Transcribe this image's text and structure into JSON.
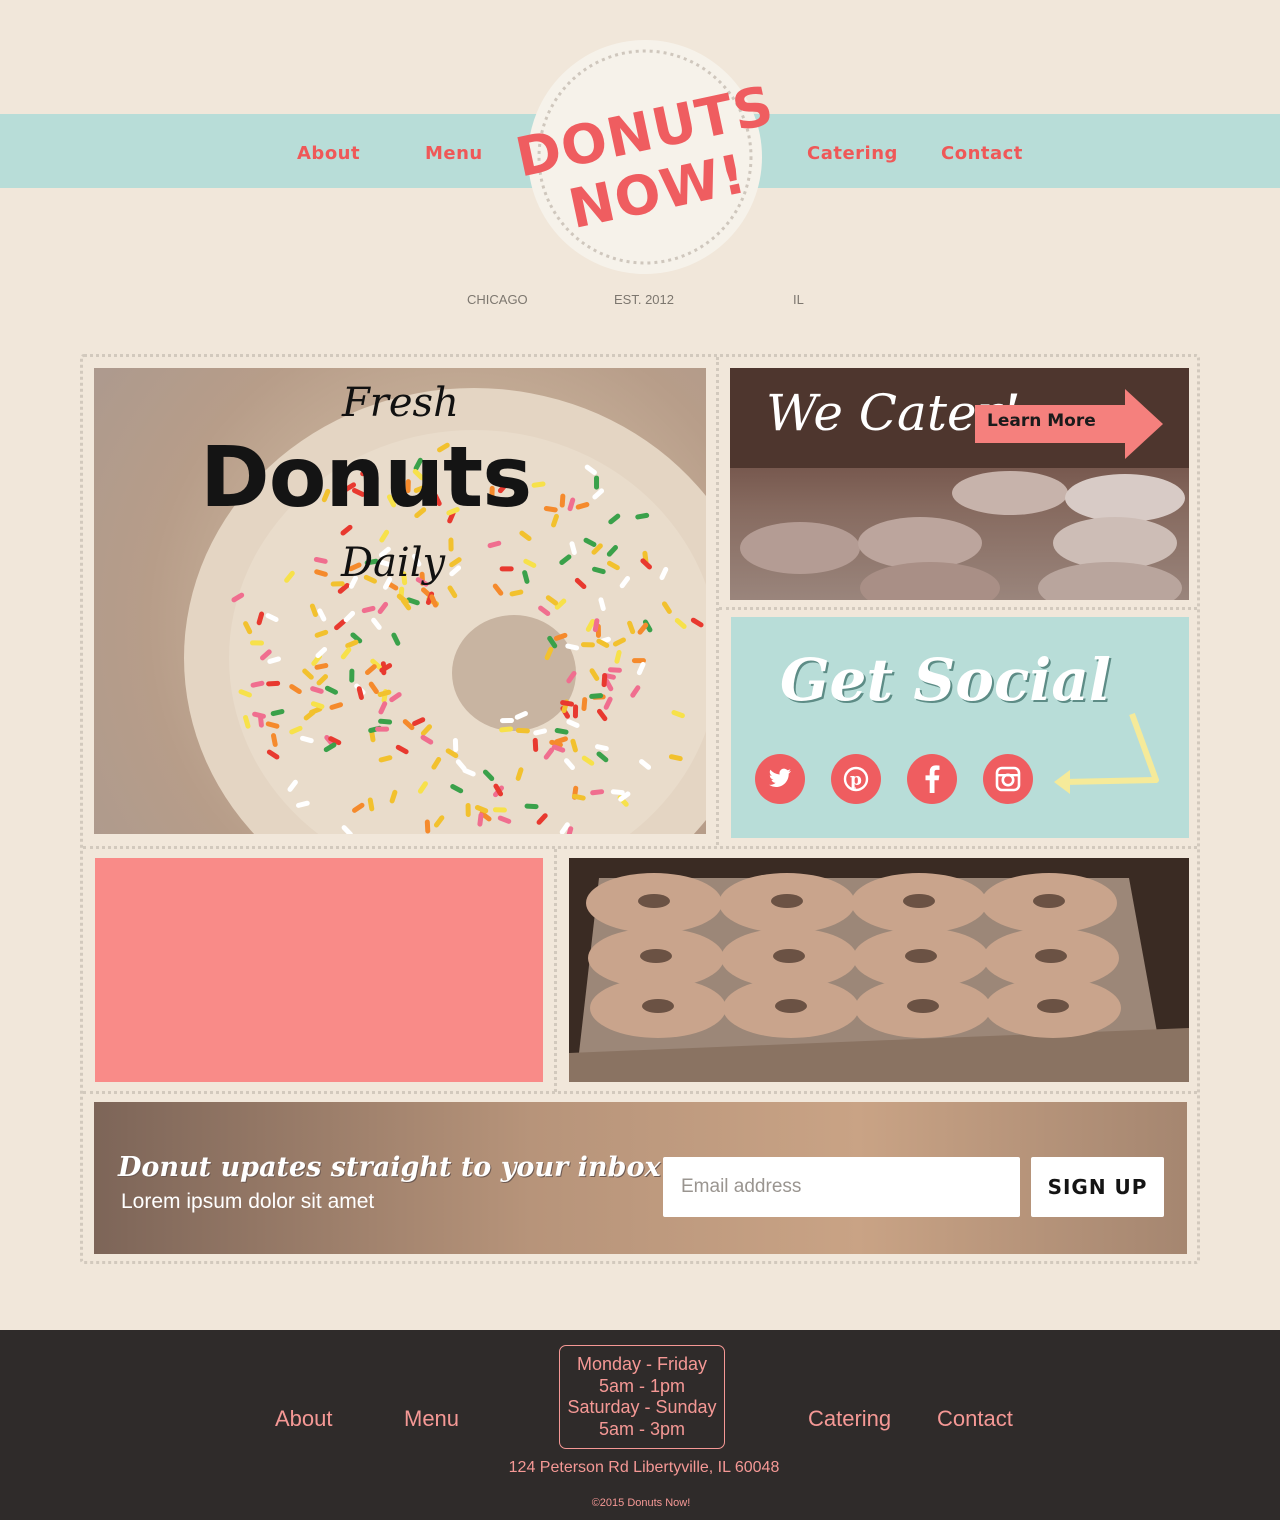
{
  "header": {
    "nav_left": [
      {
        "label": "About"
      },
      {
        "label": "Menu"
      }
    ],
    "nav_right": [
      {
        "label": "Catering"
      },
      {
        "label": "Contact"
      }
    ],
    "logo_line1": "DONUTS",
    "logo_line2": "NOW!",
    "tagline": {
      "city": "CHICAGO",
      "established": "EST. 2012",
      "state": "IL"
    }
  },
  "hero": {
    "line1": "Fresh",
    "line2": "Donuts",
    "line3": "Daily"
  },
  "cater": {
    "title": "We Cater!",
    "button_label": "Learn More"
  },
  "social": {
    "title": "Get Social",
    "icons": [
      "twitter-icon",
      "pinterest-icon",
      "facebook-icon",
      "instagram-icon"
    ]
  },
  "newsletter": {
    "title": "Donut upates straight to your inbox",
    "subtitle": "Lorem ipsum dolor sit amet",
    "email_placeholder": "Email address",
    "button_label": "SIGN UP"
  },
  "footer": {
    "nav_left": [
      {
        "label": "About"
      },
      {
        "label": "Menu"
      }
    ],
    "nav_right": [
      {
        "label": "Catering"
      },
      {
        "label": "Contact"
      }
    ],
    "hours": [
      "Monday - Friday",
      "5am - 1pm",
      "Saturday - Sunday",
      "5am - 3pm"
    ],
    "address": "124 Peterson Rd Libertyville, IL 60048",
    "copyright": "©2015 Donuts Now!"
  },
  "colors": {
    "background": "#f1e7da",
    "mint": "#b8ddd8",
    "coral": "#ef5d60",
    "pink_block": "#f98b88",
    "footer_bg": "#2f2b2a",
    "footer_text": "#f59895"
  }
}
